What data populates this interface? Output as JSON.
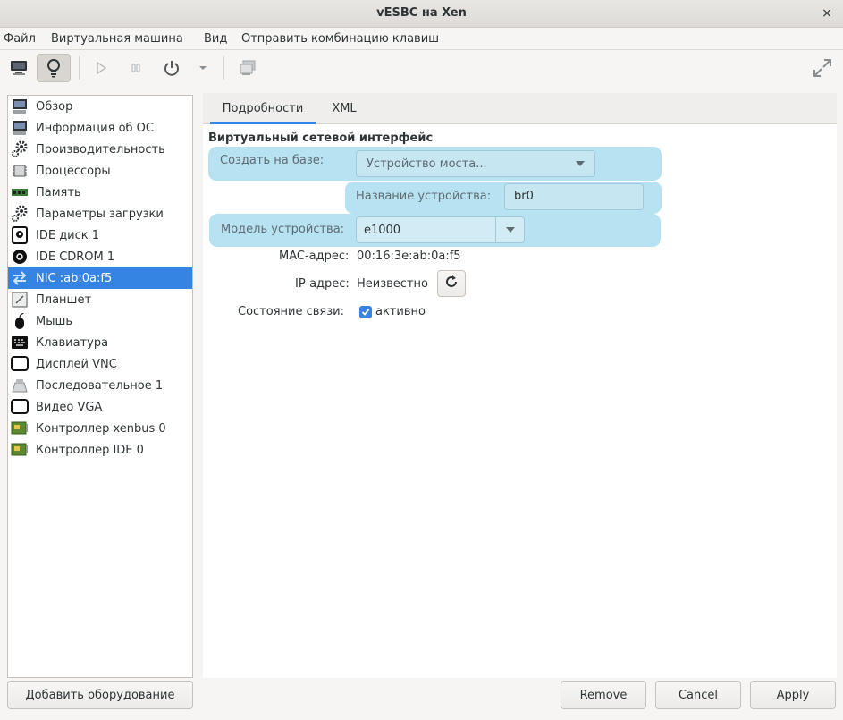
{
  "window": {
    "title": "vESBC на Xen",
    "close_glyph": "×"
  },
  "menu": [
    "Файл",
    "Виртуальная машина",
    "Вид",
    "Отправить комбинацию клавиш"
  ],
  "toolbar": {
    "icons": [
      "monitor-icon",
      "lightbulb-icon",
      "play-icon",
      "pause-icon",
      "power-icon",
      "dropdown-arrow-icon",
      "screenshot-icon",
      "fullscreen-icon"
    ]
  },
  "sidebar": {
    "items": [
      {
        "label": "Обзор",
        "icon": "monitor-info-icon"
      },
      {
        "label": "Информация об ОС",
        "icon": "monitor-os-icon"
      },
      {
        "label": "Производительность",
        "icon": "gears-icon"
      },
      {
        "label": "Процессоры",
        "icon": "cpu-icon"
      },
      {
        "label": "Память",
        "icon": "memory-icon"
      },
      {
        "label": "Параметры загрузки",
        "icon": "gears-icon"
      },
      {
        "label": "IDE диск 1",
        "icon": "disk-icon"
      },
      {
        "label": "IDE CDROM 1",
        "icon": "cdrom-icon"
      },
      {
        "label": "NIC :ab:0a:f5",
        "icon": "network-icon"
      },
      {
        "label": "Планшет",
        "icon": "tablet-icon"
      },
      {
        "label": "Мышь",
        "icon": "mouse-icon"
      },
      {
        "label": "Клавиатура",
        "icon": "keyboard-icon"
      },
      {
        "label": "Дисплей VNC",
        "icon": "display-icon"
      },
      {
        "label": "Последовательное 1",
        "icon": "serial-icon"
      },
      {
        "label": "Видео VGA",
        "icon": "video-icon"
      },
      {
        "label": "Контроллер xenbus 0",
        "icon": "controller-icon"
      },
      {
        "label": "Контроллер IDE 0",
        "icon": "controller-icon"
      }
    ],
    "selected_index": 8
  },
  "tabs": [
    "Подробности",
    "XML"
  ],
  "details": {
    "section_title": "Виртуальный сетевой интерфейс",
    "source_label": "Создать на базе:",
    "source_value": "Устройство моста...",
    "device_name_label": "Название устройства:",
    "device_name_value": "br0",
    "model_label": "Модель устройства:",
    "model_value": "e1000",
    "mac_label": "MAC-адрес:",
    "mac_value": "00:16:3e:ab:0a:f5",
    "ip_label": "IP-адрес:",
    "ip_value": "Неизвестно",
    "link_label": "Состояние связи:",
    "link_value": "активно",
    "link_checked": true
  },
  "buttons": {
    "add_hardware": "Добавить оборудование",
    "remove": "Remove",
    "cancel": "Cancel",
    "apply": "Apply"
  },
  "colors": {
    "accent": "#3584e4",
    "highlight": "#b6e2f1"
  }
}
